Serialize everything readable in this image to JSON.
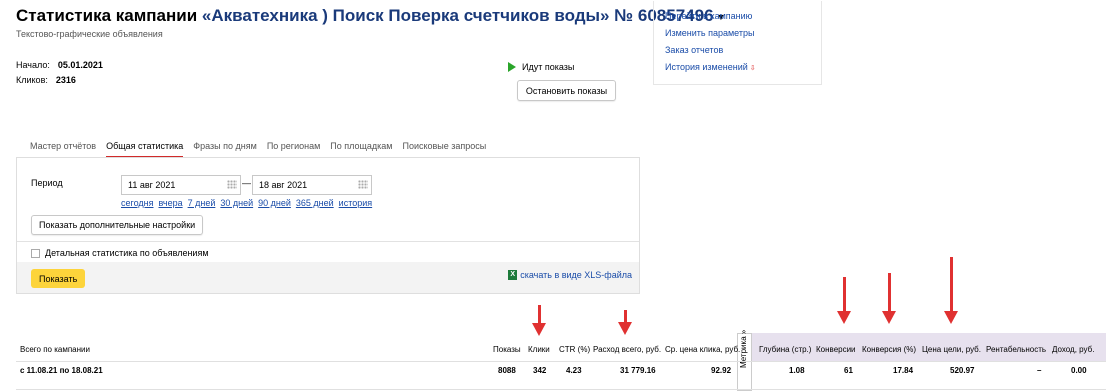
{
  "header": {
    "title_prefix": "Статистика кампании",
    "campaign": "«Акватехника ) Поиск Поверка счетчиков воды» № 60857496",
    "subtitle": "Текстово-графические объявления"
  },
  "info": {
    "start_label": "Начало:",
    "start_value": "05.01.2021",
    "clicks_label": "Кликов:",
    "clicks_value": "2316"
  },
  "status": {
    "text": "Идут показы",
    "stop_button": "Остановить показы"
  },
  "links": {
    "goto": "Перейти в кампанию",
    "edit": "Изменить параметры",
    "order": "Заказ отчетов",
    "history": "История изменений"
  },
  "tabs": [
    "Мастер отчётов",
    "Общая статистика",
    "Фразы по дням",
    "По регионам",
    "По площадкам",
    "Поисковые запросы"
  ],
  "form": {
    "period_label": "Период",
    "date_from": "11 авг 2021",
    "date_to": "18 авг 2021",
    "dash": "—",
    "quick_links": [
      "сегодня",
      "вчера",
      "7 дней",
      "30 дней",
      "90 дней",
      "365 дней",
      "история"
    ],
    "more_settings": "Показать дополнительные настройки",
    "detail_checkbox": "Детальная статистика по объявлениям",
    "show_button": "Показать",
    "xls_link": "скачать в виде XLS-файла"
  },
  "stats": {
    "header_label": "Всего по кампании",
    "row_label": "с 11.08.21 по 18.08.21",
    "metrika_tab": "Метрика »",
    "columns": {
      "shows": "Показы",
      "clicks": "Клики",
      "ctr": "CTR (%)",
      "spend": "Расход всего, руб.",
      "avg_cpc": "Ср. цена клика, руб.",
      "depth": "Глубина (стр.)",
      "conversions": "Конверсии",
      "conv_rate": "Конверсия (%)",
      "goal_price": "Цена цели, руб.",
      "profitability": "Рентабельность",
      "income": "Доход, руб."
    },
    "values": {
      "shows": "8088",
      "clicks": "342",
      "ctr": "4.23",
      "spend": "31 779.16",
      "avg_cpc": "92.92",
      "depth": "1.08",
      "conversions": "61",
      "conv_rate": "17.84",
      "goal_price": "520.97",
      "profitability": "–",
      "income": "0.00"
    }
  },
  "colors": {
    "link": "#1a4ca8",
    "accent_red": "#e03131",
    "show_button": "#fdd43b",
    "metrika_bg": "#e7e1ee"
  }
}
